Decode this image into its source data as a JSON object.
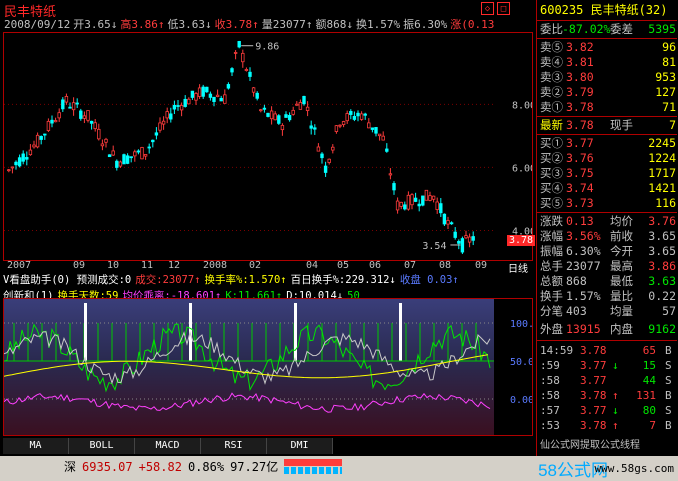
{
  "header": {
    "title": "民丰特纸",
    "info": [
      {
        "label": "2008/09/12",
        "color": "#c0c0c0"
      },
      {
        "label": "开3.65↓",
        "color": "#c0c0c0"
      },
      {
        "label": "高3.86↑",
        "color": "#ff3c3c"
      },
      {
        "label": "低3.63↓",
        "color": "#c0c0c0"
      },
      {
        "label": "收3.78↑",
        "color": "#ff3c3c"
      },
      {
        "label": "量23077↑",
        "color": "#c0c0c0"
      },
      {
        "label": "额868↓",
        "color": "#c0c0c0"
      },
      {
        "label": "换1.57%",
        "color": "#c0c0c0"
      },
      {
        "label": "振6.30%",
        "color": "#c0c0c0"
      },
      {
        "label": "涨(0.13",
        "color": "#ff3c3c"
      }
    ],
    "win_buttons": [
      "◇",
      "□"
    ]
  },
  "main_chart": {
    "price_labels": [
      "8.00",
      "6.00",
      "4.00"
    ],
    "current_price_tag": "3.78",
    "high_note": "9.86",
    "low_note": "3.54",
    "x_labels": [
      "2007",
      "09",
      "10",
      "11",
      "12",
      "2008",
      "02",
      "04",
      "05",
      "06",
      "07",
      "08",
      "09"
    ],
    "period_label": "日线"
  },
  "indicator1": {
    "text_parts": [
      {
        "t": "V看盘助手(0) 预测成交:0",
        "c": "#ffffff"
      },
      {
        "t": "成交:23077↑",
        "c": "#ff3c3c"
      },
      {
        "t": "换手率%:1.570↑",
        "c": "#ffff00"
      },
      {
        "t": "百日换手%:229.312↓",
        "c": "#ffffff"
      },
      {
        "t": "收盘 0.03↑",
        "c": "#5a7aff"
      }
    ]
  },
  "indicator2": {
    "text_parts": [
      {
        "t": "创新和(1)",
        "c": "#ffffff"
      },
      {
        "t": "换手天数:59",
        "c": "#ffff00"
      },
      {
        "t": "均价乖离:-18.601↑",
        "c": "#ff40ff"
      },
      {
        "t": "K:11.661↑",
        "c": "#00e600"
      },
      {
        "t": "D:10.014↓",
        "c": "#ffffff"
      },
      {
        "t": "50",
        "c": "#00e600"
      }
    ],
    "y_labels": [
      "100.00",
      "50.00",
      "0.00"
    ]
  },
  "tabs": [
    "MA",
    "BOLL",
    "MACD",
    "RSI",
    "DMI"
  ],
  "statusbar": {
    "market": "深",
    "index": "6935.07",
    "change": "+58.82",
    "pct": "0.86%",
    "amount": "97.27亿",
    "watermark": "58公式网",
    "watermark_url": "www.58gs.com"
  },
  "quote_panel": {
    "code_name": "600235 民丰特纸(32)",
    "weibi": {
      "label": "委比",
      "value": "-87.02%",
      "label2": "委差",
      "value2": "5395"
    },
    "sell": [
      {
        "label": "卖⑤",
        "price": "3.82",
        "vol": "96"
      },
      {
        "label": "卖④",
        "price": "3.81",
        "vol": "81"
      },
      {
        "label": "卖③",
        "price": "3.80",
        "vol": "953"
      },
      {
        "label": "卖②",
        "price": "3.79",
        "vol": "127"
      },
      {
        "label": "卖①",
        "price": "3.78",
        "vol": "71"
      }
    ],
    "latest": {
      "label": "最新",
      "price": "3.78",
      "label2": "现手",
      "vol": "7"
    },
    "buy": [
      {
        "label": "买①",
        "price": "3.77",
        "vol": "2245"
      },
      {
        "label": "买②",
        "price": "3.76",
        "vol": "1224"
      },
      {
        "label": "买③",
        "price": "3.75",
        "vol": "1717"
      },
      {
        "label": "买④",
        "price": "3.74",
        "vol": "1421"
      },
      {
        "label": "买⑤",
        "price": "3.73",
        "vol": "116"
      }
    ],
    "stats": [
      {
        "l1": "涨跌",
        "v1": "0.13",
        "l2": "均价",
        "v2": "3.76",
        "c1": "#ff3c3c",
        "c2": "#ff3c3c"
      },
      {
        "l1": "涨幅",
        "v1": "3.56%",
        "l2": "前收",
        "v2": "3.65",
        "c1": "#ff3c3c",
        "c2": "#c0c0c0"
      },
      {
        "l1": "振幅",
        "v1": "6.30%",
        "l2": "今开",
        "v2": "3.65",
        "c1": "#c0c0c0",
        "c2": "#c0c0c0"
      },
      {
        "l1": "总手",
        "v1": "23077",
        "l2": "最高",
        "v2": "3.86",
        "c1": "#c0c0c0",
        "c2": "#ff3c3c"
      },
      {
        "l1": "总额",
        "v1": "868",
        "l2": "最低",
        "v2": "3.63",
        "c1": "#c0c0c0",
        "c2": "#00e600"
      },
      {
        "l1": "换手",
        "v1": "1.57%",
        "l2": "量比",
        "v2": "0.22",
        "c1": "#c0c0c0",
        "c2": "#c0c0c0"
      },
      {
        "l1": "分笔",
        "v1": "403",
        "l2": "均量",
        "v2": "57",
        "c1": "#c0c0c0",
        "c2": "#c0c0c0"
      }
    ],
    "outer_inner": {
      "l1": "外盘",
      "v1": "13915",
      "l2": "内盘",
      "v2": "9162"
    },
    "ticks": [
      {
        "time": "14:59",
        "price": "3.78",
        "arrow": "",
        "vol": "65",
        "bs": "B",
        "pc": "#ff3c3c",
        "vc": "#ff3c3c"
      },
      {
        "time": ":59",
        "price": "3.77",
        "arrow": "↓",
        "vol": "15",
        "bs": "S",
        "pc": "#ff3c3c",
        "vc": "#00e600"
      },
      {
        "time": ":58",
        "price": "3.77",
        "arrow": "",
        "vol": "44",
        "bs": "S",
        "pc": "#ff3c3c",
        "vc": "#00e600"
      },
      {
        "time": ":58",
        "price": "3.78",
        "arrow": "↑",
        "vol": "131",
        "bs": "B",
        "pc": "#ff3c3c",
        "vc": "#ff3c3c"
      },
      {
        "time": ":57",
        "price": "3.77",
        "arrow": "↓",
        "vol": "80",
        "bs": "S",
        "pc": "#ff3c3c",
        "vc": "#00e600"
      },
      {
        "time": ":53",
        "price": "3.78",
        "arrow": "↑",
        "vol": "7",
        "bs": "B",
        "pc": "#ff3c3c",
        "vc": "#ff3c3c"
      }
    ],
    "bottom_partial": "仙公式网提取公式线程"
  },
  "colors": {
    "up": "#ff3c3c",
    "down": "#00ffff",
    "frame": "#b00000",
    "accent_yellow": "#ffff00"
  }
}
